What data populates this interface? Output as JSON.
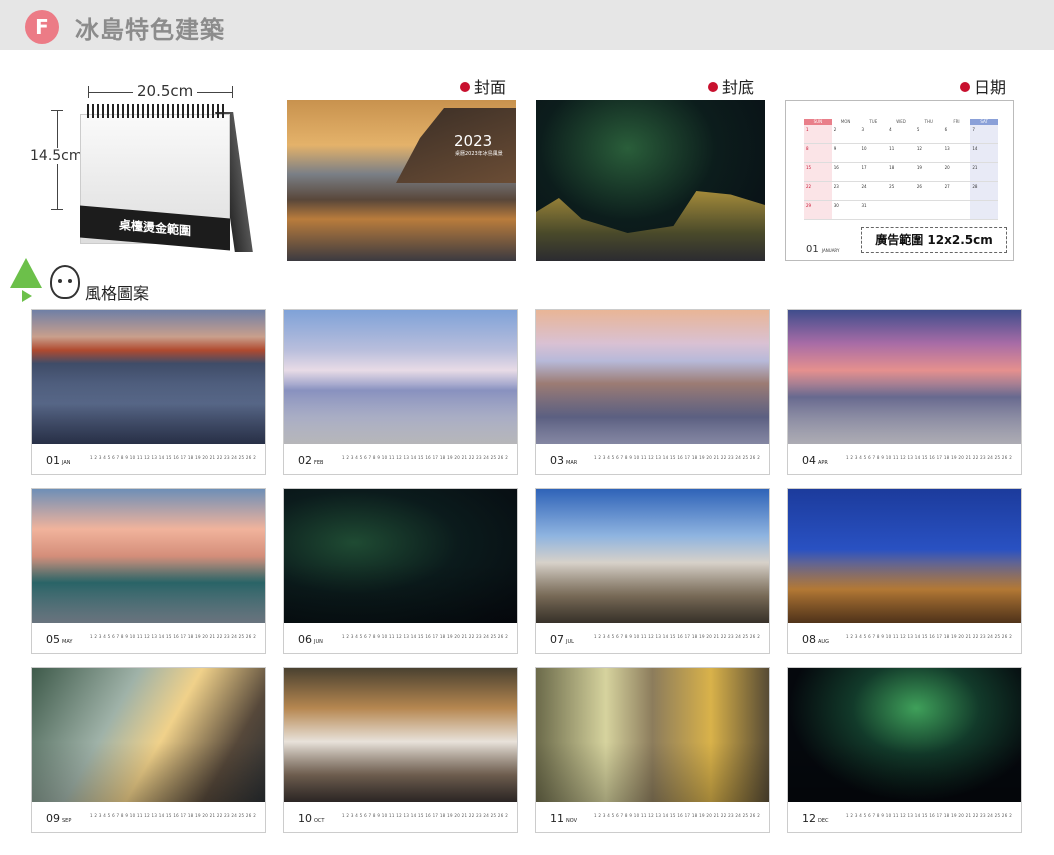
{
  "header": {
    "badge": "F",
    "title": "冰島特色建築"
  },
  "desk_calendar": {
    "width_label": "20.5cm",
    "height_label": "14.5cm",
    "strip_text": "桌檯燙金範圍"
  },
  "sections": {
    "cover_label": "封面",
    "back_label": "封底",
    "date_label": "日期",
    "style_label": "風格圖案"
  },
  "cover": {
    "year": "2023",
    "subtitle": "桌曆2023年冰島風景"
  },
  "date_panel": {
    "weekdays": [
      "SUN",
      "MON",
      "TUE",
      "WED",
      "THU",
      "FRI",
      "SAT"
    ],
    "rows": [
      [
        "1",
        "2",
        "3",
        "4",
        "5",
        "6",
        "7"
      ],
      [
        "8",
        "9",
        "10",
        "11",
        "12",
        "13",
        "14"
      ],
      [
        "15",
        "16",
        "17",
        "18",
        "19",
        "20",
        "21"
      ],
      [
        "22",
        "23",
        "24",
        "25",
        "26",
        "27",
        "28"
      ],
      [
        "29",
        "30",
        "31",
        "",
        "",
        "",
        ""
      ]
    ],
    "month_number": "01",
    "month_name": "JANUARY",
    "ad_area_label": "廣告範圍 12x2.5cm"
  },
  "months": [
    {
      "num": "01",
      "abbr": "JAN"
    },
    {
      "num": "02",
      "abbr": "FEB"
    },
    {
      "num": "03",
      "abbr": "MAR"
    },
    {
      "num": "04",
      "abbr": "APR"
    },
    {
      "num": "05",
      "abbr": "MAY"
    },
    {
      "num": "06",
      "abbr": "JUN"
    },
    {
      "num": "07",
      "abbr": "JUL"
    },
    {
      "num": "08",
      "abbr": "AUG"
    },
    {
      "num": "09",
      "abbr": "SEP"
    },
    {
      "num": "10",
      "abbr": "OCT"
    },
    {
      "num": "11",
      "abbr": "NOV"
    },
    {
      "num": "12",
      "abbr": "DEC"
    }
  ],
  "mini_strip_days": "1 2 3 4 5 6 7 8 9 10 11 12 13 14 15 16 17 18 19 20 21 22 23 24 25 26 27 28 29 30 31",
  "colors": {
    "badge": "#ec7b86",
    "header_bar": "#e6e6e6",
    "section_dot": "#c8102e",
    "style_icon_green": "#6cc04a"
  }
}
